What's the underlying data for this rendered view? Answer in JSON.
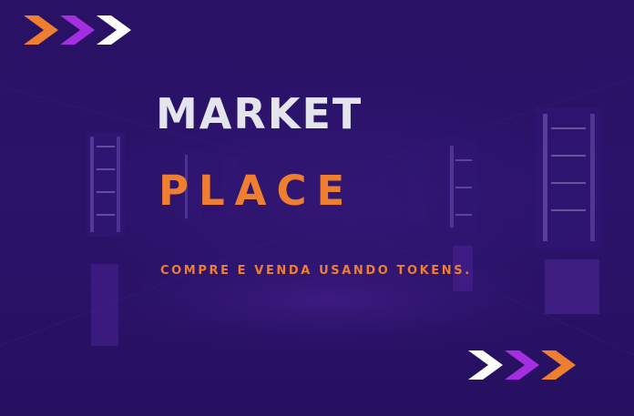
{
  "hero": {
    "title_line1": "MARKET",
    "title_line2": "PLACE",
    "tagline": "COMPRE E VENDA USANDO TOKENS."
  },
  "decor": {
    "top_chevrons": [
      "chevron-orange",
      "chevron-purple",
      "chevron-white"
    ],
    "bottom_chevrons": [
      "chevron-white",
      "chevron-purple",
      "chevron-orange"
    ]
  },
  "colors": {
    "background": "#2a1164",
    "title_primary": "#e4e4ec",
    "accent_orange": "#ee7e30",
    "accent_purple": "#a52ee0",
    "accent_white": "#ffffff"
  }
}
